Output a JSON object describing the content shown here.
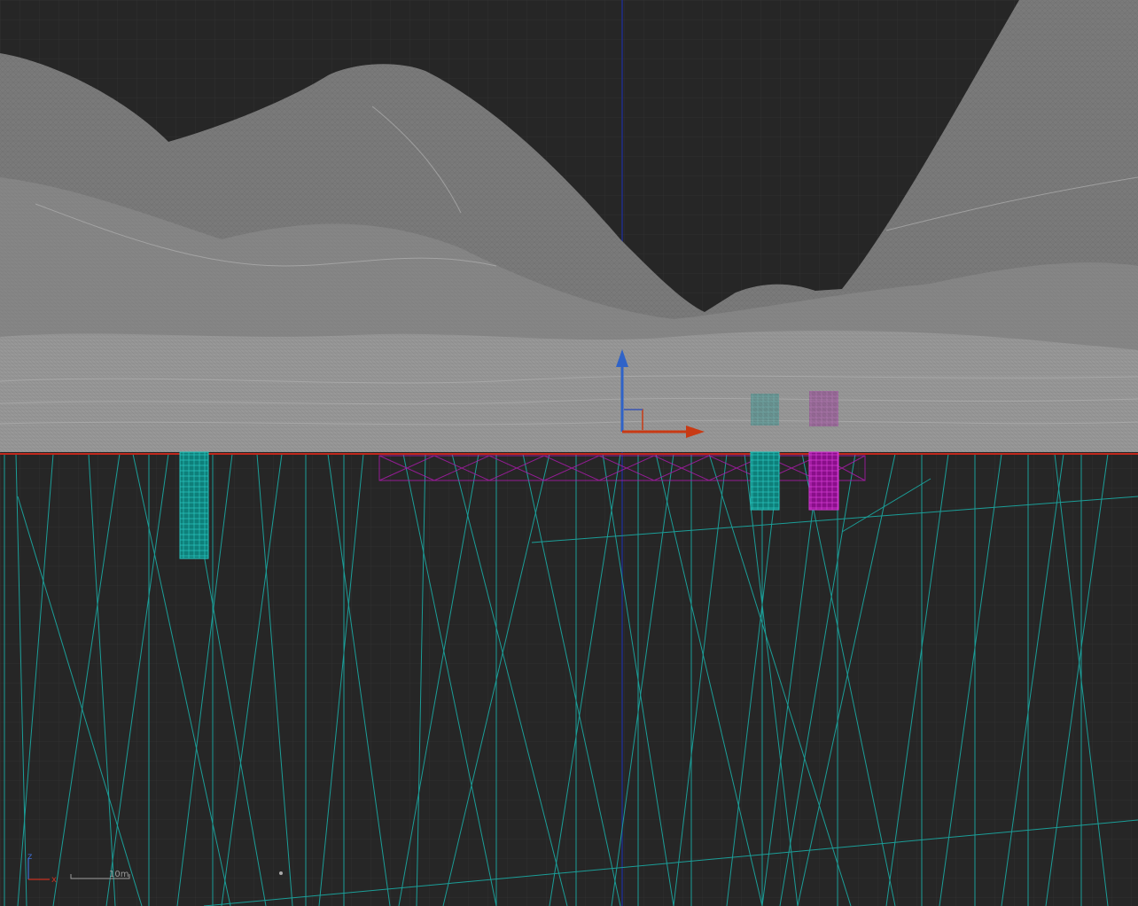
{
  "viewport": {
    "view": "front",
    "mode": "wireframe",
    "background_color": "#262626",
    "grid_color": "#2f2f2f",
    "terrain_color": "#8e8e8e",
    "cyan_object_color": "#1aa6a0",
    "magenta_object_color": "#b01ab0",
    "ground_line_color": "#c0281c"
  },
  "gizmo": {
    "z_axis_color": "#2f63c8",
    "x_axis_color": "#c83a14"
  },
  "axis_indicator": {
    "z_label": "z",
    "x_label": "x",
    "z_color": "#3d6fd6",
    "x_color": "#c83020"
  },
  "scale_bar": {
    "label": "10m"
  }
}
